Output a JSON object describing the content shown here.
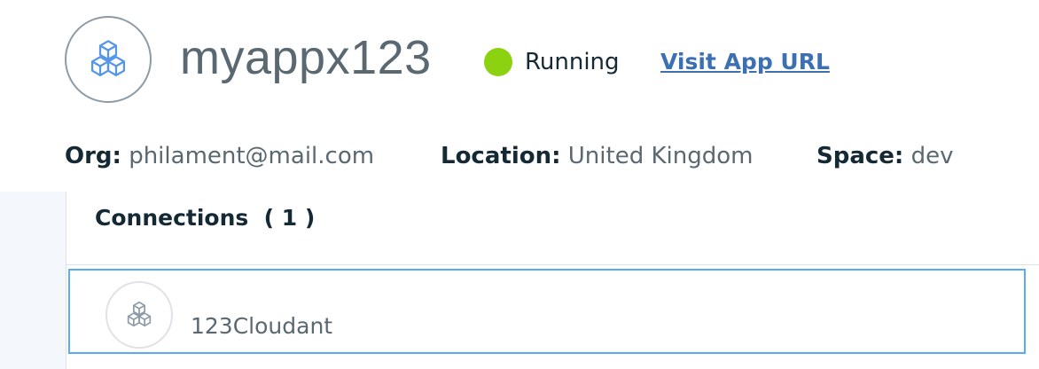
{
  "app": {
    "name": "myappx123",
    "icon": "cube-cluster-icon",
    "status": {
      "label": "Running",
      "color": "#8cd211"
    },
    "visit_link": "Visit App URL"
  },
  "meta": {
    "org": {
      "key": "Org:",
      "value": "philament@mail.com"
    },
    "location": {
      "key": "Location:",
      "value": "United Kingdom"
    },
    "space": {
      "key": "Space:",
      "value": "dev"
    }
  },
  "connections": {
    "title": "Connections  ( 1 )",
    "items": [
      {
        "name": "123Cloudant",
        "icon": "cube-cluster-icon"
      }
    ]
  },
  "colors": {
    "link": "#3d70b2",
    "app_icon": "#5596e6",
    "connection_icon": "#8c9ba5",
    "selected_border": "#5aaafa"
  }
}
